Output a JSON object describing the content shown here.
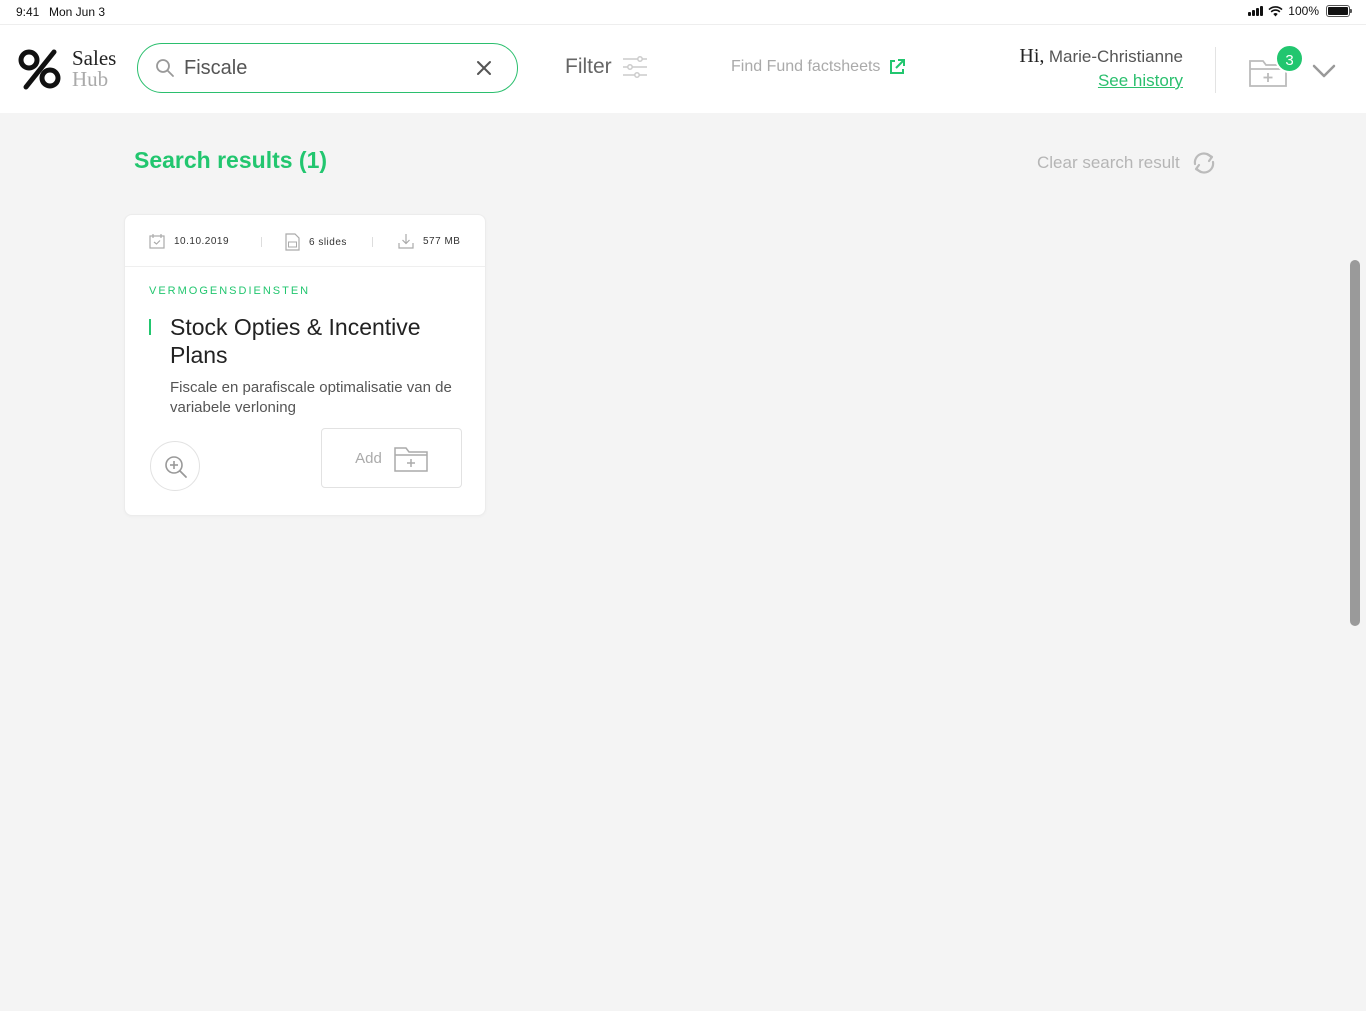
{
  "status_bar": {
    "time": "9:41",
    "date": "Mon Jun 3",
    "battery": "100%"
  },
  "brand": {
    "line1": "Sales",
    "line2": "Hub"
  },
  "search": {
    "value": "Fiscale",
    "placeholder": ""
  },
  "filter": {
    "label": "Filter"
  },
  "factsheets": {
    "label": "Find Fund factsheets"
  },
  "user": {
    "greeting": "Hi,",
    "name": "Marie-Christianne",
    "history_label": "See history"
  },
  "cart": {
    "count": "3"
  },
  "results": {
    "title": "Search results (1)",
    "clear_label": "Clear search result"
  },
  "card": {
    "date": "10.10.2019",
    "slides": "6 slides",
    "size": "577 MB",
    "category": "VERMOGENSDIENSTEN",
    "title": "Stock Opties & Incentive Plans",
    "description": "Fiscale en parafiscale optimalisatie van de variabele verloning",
    "add_label": "Add"
  },
  "colors": {
    "accent": "#22c66f",
    "background": "#f4f4f4",
    "muted": "#aaaaaa"
  }
}
